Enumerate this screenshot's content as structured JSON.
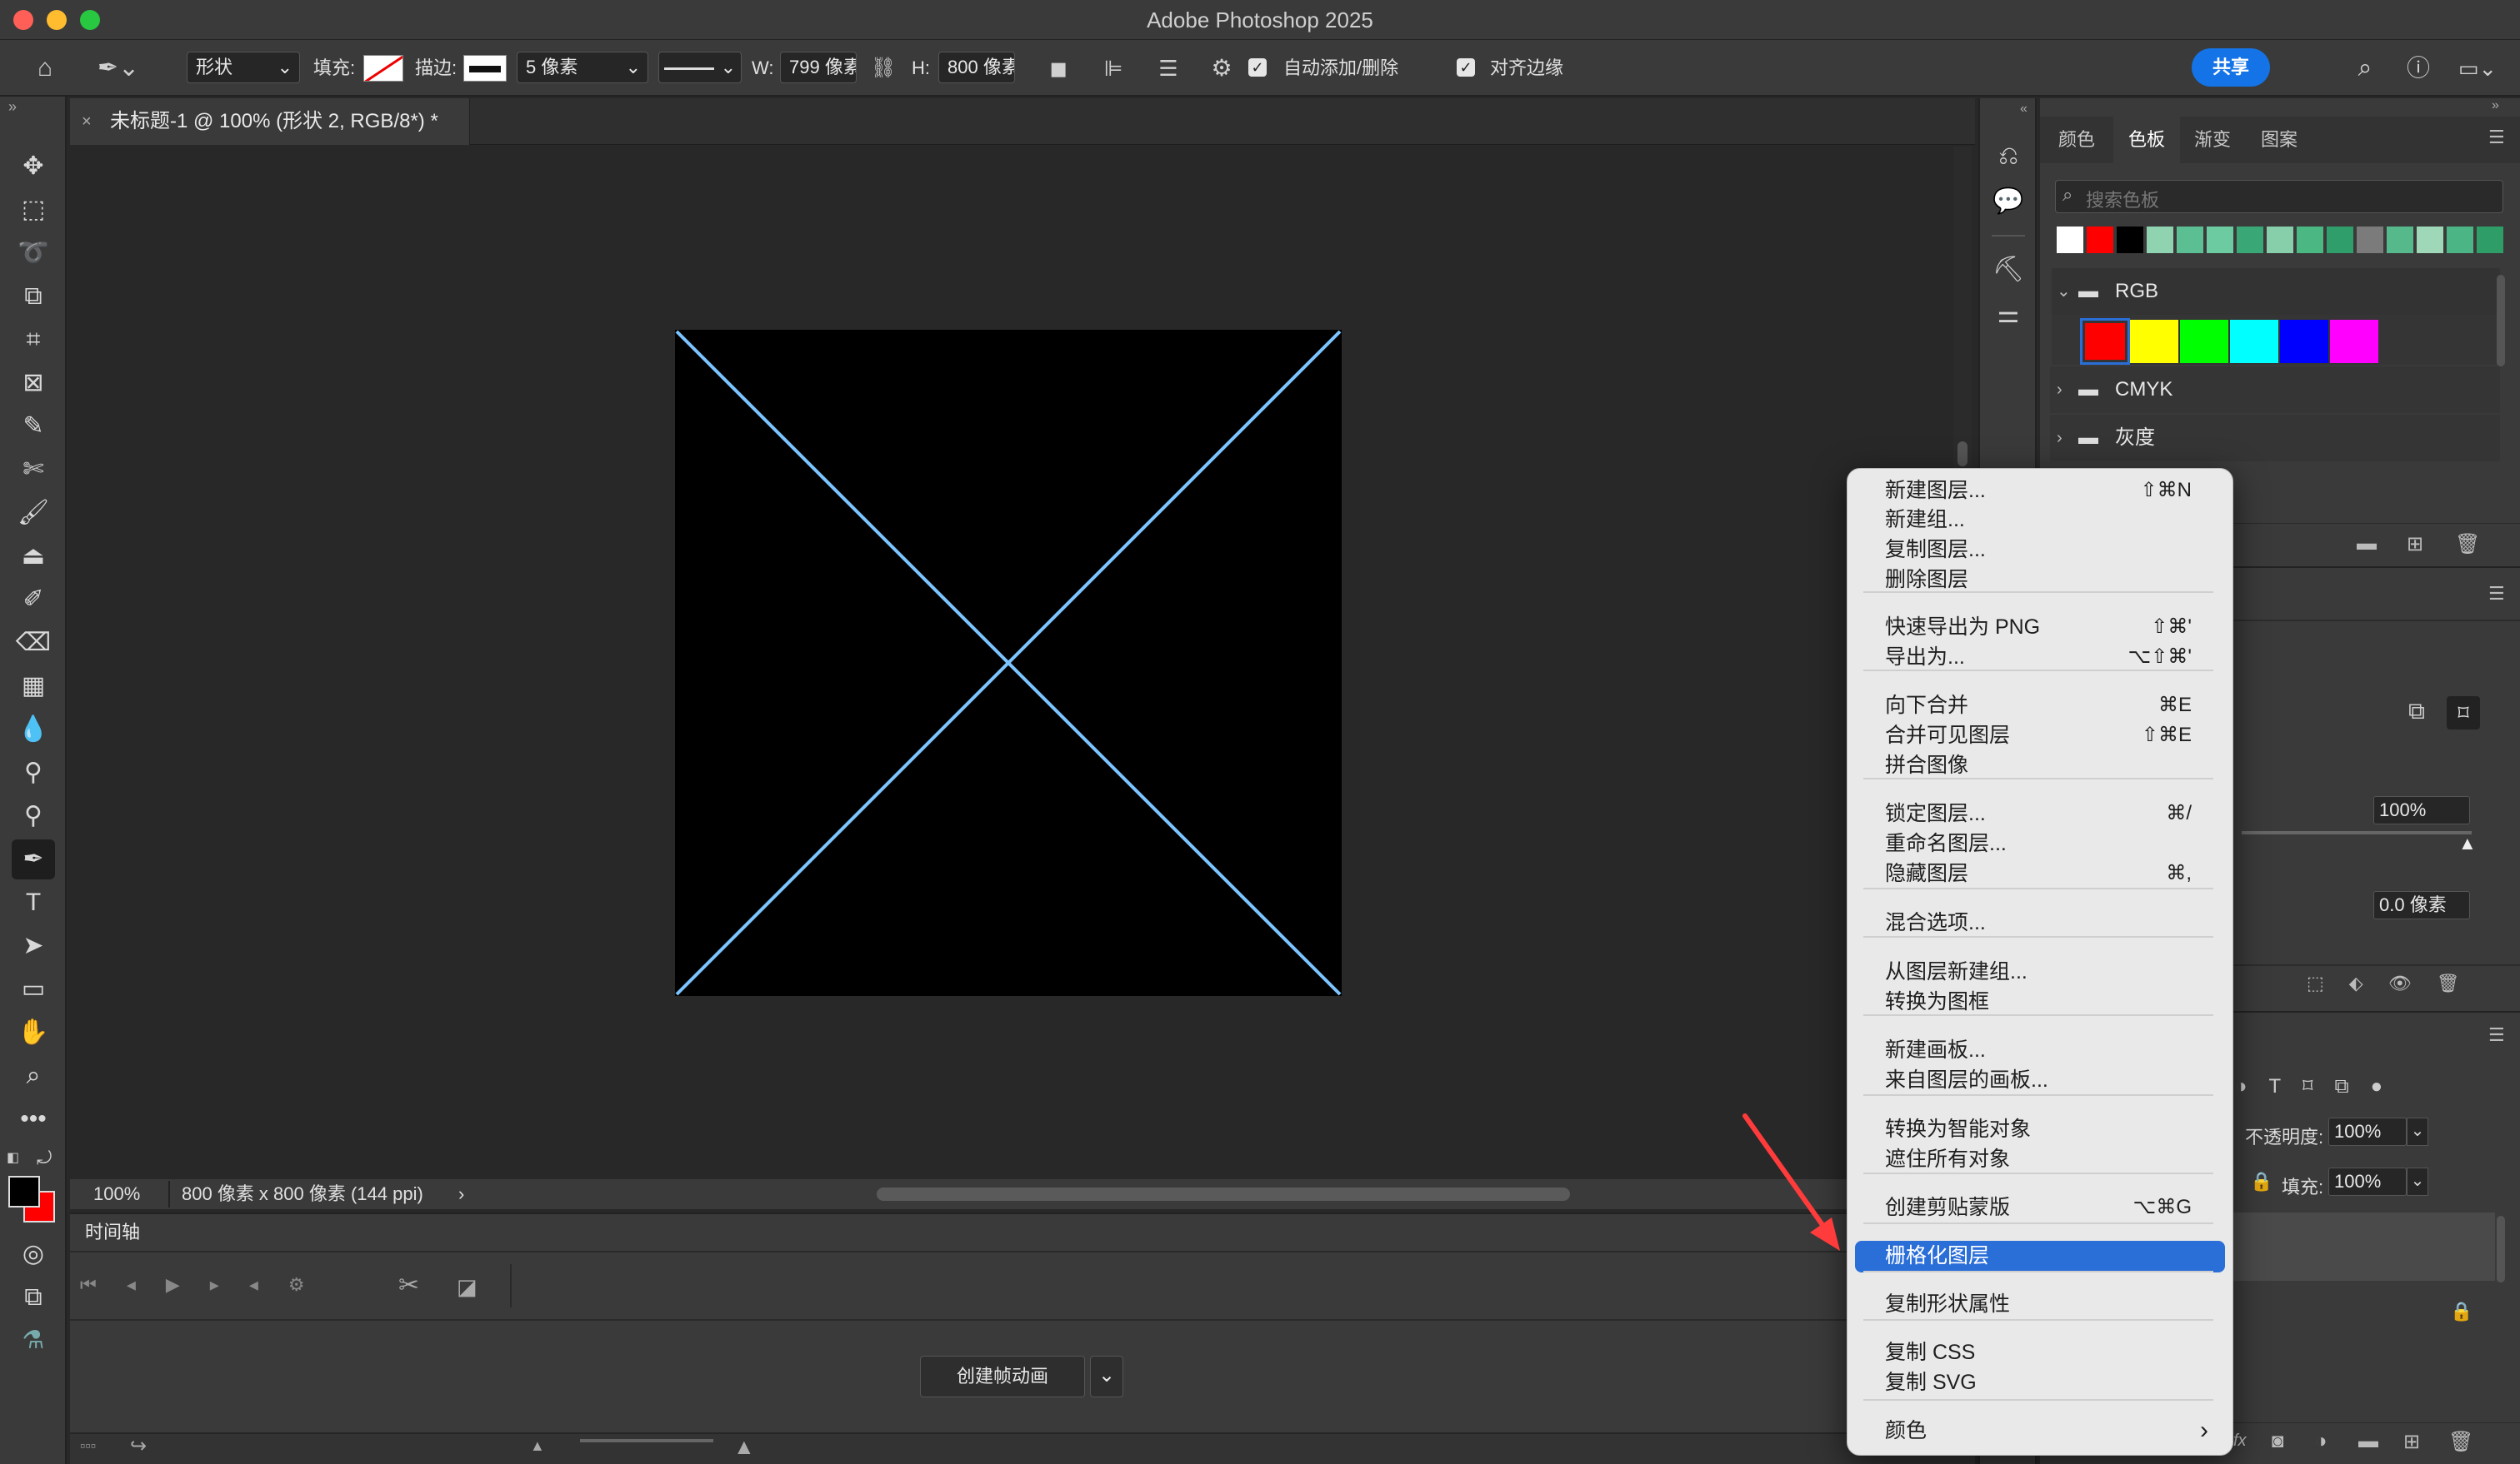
{
  "app": {
    "title": "Adobe Photoshop 2025"
  },
  "options": {
    "shape_mode": "形状",
    "fill_label": "填充:",
    "stroke_label": "描边:",
    "stroke_width": "5 像素",
    "w_label": "W:",
    "w_value": "799 像素",
    "h_label": "H:",
    "h_value": "800 像素",
    "auto_add_delete": "自动添加/删除",
    "align_edges": "对齐边缘",
    "share_button": "共享"
  },
  "document": {
    "tab_title": "未标题-1 @ 100% (形状 2, RGB/8*) *",
    "zoom": "100%",
    "size_info": "800 像素 x 800 像素 (144 ppi)"
  },
  "timeline": {
    "tab": "时间轴",
    "create_frame_animation": "创建帧动画"
  },
  "swatches_panel": {
    "tabs": [
      "颜色",
      "色板",
      "渐变",
      "图案"
    ],
    "active_tab": "色板",
    "search_placeholder": "搜索色板",
    "recent_colors": [
      "#ffffff",
      "#ff0000",
      "#000000",
      "#8fd3b0",
      "#5cbf94",
      "#6ccba0",
      "#3aa876",
      "#86cfaa",
      "#4bb884",
      "#2f9e6a",
      "#7b7b7b",
      "#56b98c",
      "#9fd8b8",
      "#4cb585",
      "#2e9d67"
    ],
    "groups": [
      {
        "name": "RGB",
        "colors": [
          "#ff0000",
          "#ffff00",
          "#00ff00",
          "#00ffff",
          "#0000ff",
          "#ff00ff"
        ]
      },
      {
        "name": "CMYK"
      },
      {
        "name": "灰度"
      }
    ]
  },
  "properties_panel": {
    "opacity_value": "100%",
    "feather_value": "0.0 像素"
  },
  "layers_panel": {
    "opacity_label": "不透明度:",
    "opacity_value": "100%",
    "fill_label": "填充:",
    "fill_value": "100%"
  },
  "context_menu": {
    "items": [
      {
        "label": "新建图层...",
        "shortcut": "⇧⌘N"
      },
      {
        "label": "新建组..."
      },
      {
        "label": "复制图层..."
      },
      {
        "label": "删除图层"
      },
      {
        "label": "快速导出为 PNG",
        "shortcut": "⇧⌘'"
      },
      {
        "label": "导出为...",
        "shortcut": "⌥⇧⌘'"
      },
      {
        "label": "向下合并",
        "shortcut": "⌘E"
      },
      {
        "label": "合并可见图层",
        "shortcut": "⇧⌘E"
      },
      {
        "label": "拼合图像"
      },
      {
        "label": "锁定图层...",
        "shortcut": "⌘/"
      },
      {
        "label": "重命名图层..."
      },
      {
        "label": "隐藏图层",
        "shortcut": "⌘,"
      },
      {
        "label": "混合选项..."
      },
      {
        "label": "从图层新建组..."
      },
      {
        "label": "转换为图框"
      },
      {
        "label": "新建画板..."
      },
      {
        "label": "来自图层的画板..."
      },
      {
        "label": "转换为智能对象"
      },
      {
        "label": "遮住所有对象"
      },
      {
        "label": "创建剪贴蒙版",
        "shortcut": "⌥⌘G"
      },
      {
        "label": "栅格化图层",
        "highlighted": true
      },
      {
        "label": "复制形状属性"
      },
      {
        "label": "复制 CSS"
      },
      {
        "label": "复制 SVG"
      },
      {
        "label": "颜色",
        "submenu": "›"
      }
    ]
  },
  "colors": {
    "highlight": "#2a6ed8",
    "annotation_arrow": "#ff3b3b",
    "path_line": "#7cc4ff",
    "share": "#1473e6"
  }
}
